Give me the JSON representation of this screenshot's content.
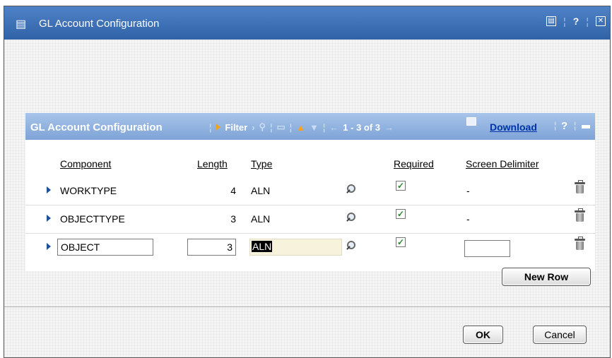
{
  "dialog": {
    "title": "GL Account Configuration",
    "controls": [
      "▤",
      "?",
      "✕"
    ]
  },
  "table": {
    "title": "GL Account Configuration",
    "toolbar": {
      "filter_label": "Filter",
      "pagination": "1 - 3 of 3",
      "download_label": "Download",
      "help_label": "?"
    },
    "columns": {
      "component": "Component",
      "length": "Length",
      "type": "Type",
      "required": "Required",
      "screen_delimiter": "Screen Delimiter"
    },
    "rows": [
      {
        "component": "WORKTYPE",
        "length": "4",
        "type": "ALN",
        "required": true,
        "screen_delimiter": "-"
      },
      {
        "component": "OBJECTTYPE",
        "length": "3",
        "type": "ALN",
        "required": true,
        "screen_delimiter": "-"
      },
      {
        "component": "OBJECT",
        "length": "3",
        "type": "ALN",
        "required": true,
        "screen_delimiter": ""
      }
    ],
    "new_row_label": "New Row"
  },
  "footer": {
    "ok_label": "OK",
    "cancel_label": "Cancel"
  },
  "colors": {
    "title_bar": "#3a6fb5",
    "table_header": "#8fb2e0",
    "link": "#0033aa",
    "accent_arrow": "#f7a21b"
  }
}
